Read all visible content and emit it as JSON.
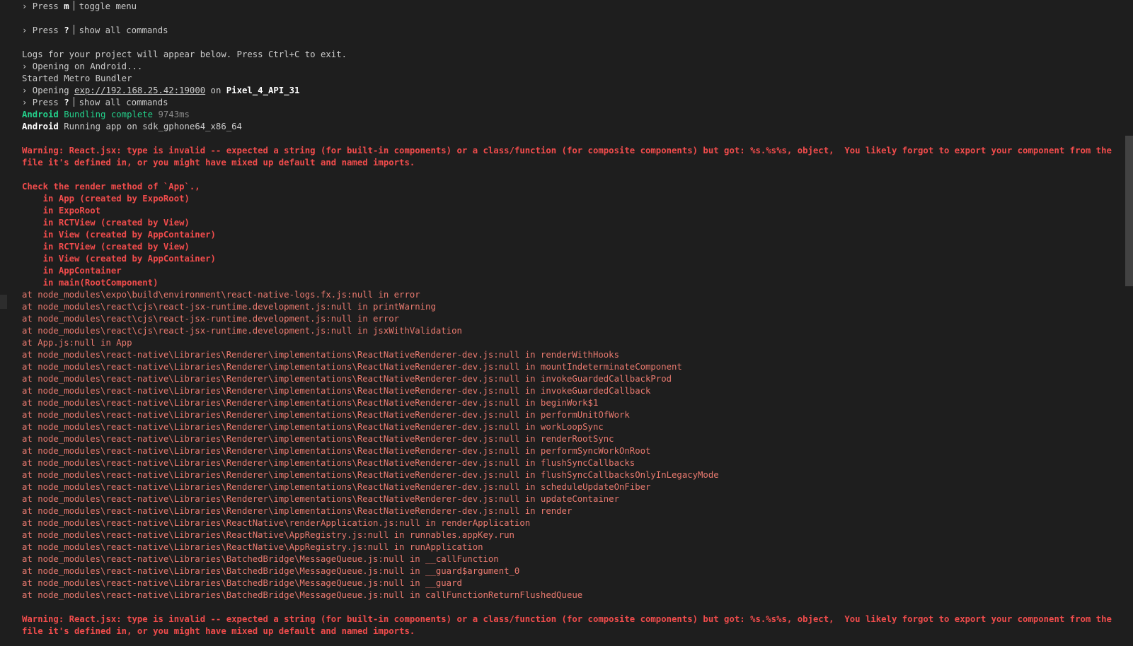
{
  "menu": [
    {
      "prefix": "› Press ",
      "key": "m",
      "desc": "toggle menu"
    },
    {
      "prefix": "› Press ",
      "key": "?",
      "desc": "show all commands"
    }
  ],
  "log_intro": "Logs for your project will appear below. Press Ctrl+C to exit.",
  "opening_android": "› Opening on Android...",
  "started_metro": "Started Metro Bundler",
  "opening_url": {
    "prefix": "› Opening ",
    "url": "exp://192.168.25.42:19000",
    "mid": " on ",
    "device": "Pixel_4_API_31"
  },
  "show_all": {
    "prefix": "› Press ",
    "key": "?",
    "desc": "show all commands"
  },
  "bundling": {
    "platform": "Android",
    "text": " Bundling complete ",
    "time": "9743ms"
  },
  "running": {
    "platform": "Android",
    "text": " Running app on sdk_gphone64_x86_64"
  },
  "warning_text": "Warning: React.jsx: type is invalid -- expected a string (for built-in components) or a class/function (for composite components) but got: %s.%s%s, object,  You likely forgot to export your component from the file it's defined in, or you might have mixed up default and named imports.",
  "check_render": "Check the render method of `App`.,",
  "component_stack": [
    "    in App (created by ExpoRoot)",
    "    in ExpoRoot",
    "    in RCTView (created by View)",
    "    in View (created by AppContainer)",
    "    in RCTView (created by View)",
    "    in View (created by AppContainer)",
    "    in AppContainer",
    "    in main(RootComponent)"
  ],
  "stack_trace": [
    "at node_modules\\expo\\build\\environment\\react-native-logs.fx.js:null in error",
    "at node_modules\\react\\cjs\\react-jsx-runtime.development.js:null in printWarning",
    "at node_modules\\react\\cjs\\react-jsx-runtime.development.js:null in error",
    "at node_modules\\react\\cjs\\react-jsx-runtime.development.js:null in jsxWithValidation",
    "at App.js:null in App",
    "at node_modules\\react-native\\Libraries\\Renderer\\implementations\\ReactNativeRenderer-dev.js:null in renderWithHooks",
    "at node_modules\\react-native\\Libraries\\Renderer\\implementations\\ReactNativeRenderer-dev.js:null in mountIndeterminateComponent",
    "at node_modules\\react-native\\Libraries\\Renderer\\implementations\\ReactNativeRenderer-dev.js:null in invokeGuardedCallbackProd",
    "at node_modules\\react-native\\Libraries\\Renderer\\implementations\\ReactNativeRenderer-dev.js:null in invokeGuardedCallback",
    "at node_modules\\react-native\\Libraries\\Renderer\\implementations\\ReactNativeRenderer-dev.js:null in beginWork$1",
    "at node_modules\\react-native\\Libraries\\Renderer\\implementations\\ReactNativeRenderer-dev.js:null in performUnitOfWork",
    "at node_modules\\react-native\\Libraries\\Renderer\\implementations\\ReactNativeRenderer-dev.js:null in workLoopSync",
    "at node_modules\\react-native\\Libraries\\Renderer\\implementations\\ReactNativeRenderer-dev.js:null in renderRootSync",
    "at node_modules\\react-native\\Libraries\\Renderer\\implementations\\ReactNativeRenderer-dev.js:null in performSyncWorkOnRoot",
    "at node_modules\\react-native\\Libraries\\Renderer\\implementations\\ReactNativeRenderer-dev.js:null in flushSyncCallbacks",
    "at node_modules\\react-native\\Libraries\\Renderer\\implementations\\ReactNativeRenderer-dev.js:null in flushSyncCallbacksOnlyInLegacyMode",
    "at node_modules\\react-native\\Libraries\\Renderer\\implementations\\ReactNativeRenderer-dev.js:null in scheduleUpdateOnFiber",
    "at node_modules\\react-native\\Libraries\\Renderer\\implementations\\ReactNativeRenderer-dev.js:null in updateContainer",
    "at node_modules\\react-native\\Libraries\\Renderer\\implementations\\ReactNativeRenderer-dev.js:null in render",
    "at node_modules\\react-native\\Libraries\\ReactNative\\renderApplication.js:null in renderApplication",
    "at node_modules\\react-native\\Libraries\\ReactNative\\AppRegistry.js:null in runnables.appKey.run",
    "at node_modules\\react-native\\Libraries\\ReactNative\\AppRegistry.js:null in runApplication",
    "at node_modules\\react-native\\Libraries\\BatchedBridge\\MessageQueue.js:null in __callFunction",
    "at node_modules\\react-native\\Libraries\\BatchedBridge\\MessageQueue.js:null in __guard$argument_0",
    "at node_modules\\react-native\\Libraries\\BatchedBridge\\MessageQueue.js:null in __guard",
    "at node_modules\\react-native\\Libraries\\BatchedBridge\\MessageQueue.js:null in callFunctionReturnFlushedQueue"
  ],
  "colors": {
    "background": "#1e1e1e",
    "text": "#cccccc",
    "success": "#23d18b",
    "warning": "#f14c4c",
    "trace": "#e97a6f"
  }
}
